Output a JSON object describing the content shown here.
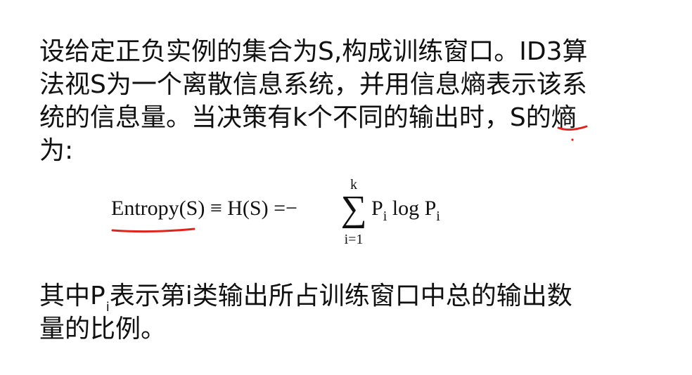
{
  "paragraph1": {
    "lines": [
      "设给定正负实例的集合为S,构成训练窗口。ID3算",
      "法视S为一个离散信息系统，并用信息熵表示该系",
      "统的信息量。当决策有k个不同的输出时，S的熵",
      "为:"
    ]
  },
  "formula": {
    "lhs": "Entropy(S)",
    "equiv": "≡",
    "h": "H(S)",
    "equals": "=",
    "minus": "−",
    "sum_symbol": "∑",
    "sum_upper": "k",
    "sum_lower": "i=1",
    "p1": "P",
    "p1_sub": "i",
    "log": "log",
    "p2": "P",
    "p2_sub": "i"
  },
  "paragraph2": {
    "prefix": "其中P",
    "prefix_sub": "i",
    "line1_rest": "表示第i类输出所占训练窗口中总的输出数",
    "line2": "量的比例。"
  },
  "annotations": {
    "color": "#e0231c"
  }
}
